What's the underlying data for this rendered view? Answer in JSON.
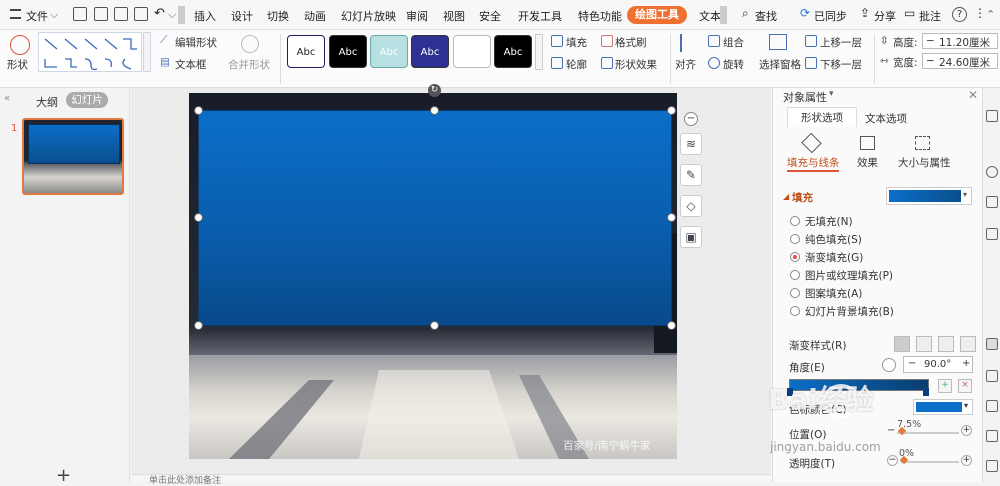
{
  "menubar": {
    "file": "文件",
    "tabs": [
      "插入",
      "设计",
      "切换",
      "动画",
      "幻灯片放映",
      "审阅",
      "视图",
      "安全",
      "开发工具",
      "特色功能"
    ],
    "active_tab": "绘图工具",
    "text_tab": "文本",
    "search": "查找",
    "sync": "已同步",
    "share": "分享",
    "comment": "批注",
    "help": "?"
  },
  "ribbon": {
    "shape": "形状",
    "edit_shape": "编辑形状",
    "textbox": "文本框",
    "merge_shape": "合并形状",
    "style_label": "Abc",
    "fill": "填充",
    "format_painter": "格式刷",
    "outline": "轮廓",
    "shape_effect": "形状效果",
    "align": "对齐",
    "group": "组合",
    "rotate": "旋转",
    "select_pane": "选择窗格",
    "bring_forward": "上移一层",
    "send_backward": "下移一层",
    "height_label": "高度:",
    "height_value": "11.20厘米",
    "width_label": "宽度:",
    "width_value": "24.60厘米"
  },
  "leftpane": {
    "outline_tab": "大纲",
    "slides_tab": "幻灯片",
    "slide_number": "1",
    "add": "+"
  },
  "notes": "单击此处添加备注",
  "slide": {
    "watermark": "百家号/南宁蜗牛家"
  },
  "panel": {
    "title": "对象属性",
    "tab_shape": "形状选项",
    "tab_text": "文本选项",
    "sub_fill_line": "填充与线条",
    "sub_effect": "效果",
    "sub_size": "大小与属性",
    "fill_section": "填充",
    "fill_options": [
      "无填充(N)",
      "纯色填充(S)",
      "渐变填充(G)",
      "图片或纹理填充(P)",
      "图案填充(A)",
      "幻灯片背景填充(B)"
    ],
    "selected_fill": 2,
    "gradient_style": "渐变样式(R)",
    "angle_label": "角度(E)",
    "angle_value": "90.0°",
    "color_label": "色标颜色(C)",
    "position_label": "位置(O)",
    "position_value": "7.5%",
    "transparency_label": "透明度(T)",
    "transparency_value": "0%"
  },
  "watermark_site": {
    "brand": "Bai经验",
    "url": "jingyan.baidu.com"
  },
  "colors": {
    "accent": "#f07030",
    "fill_blue": "#0b6ec8"
  }
}
